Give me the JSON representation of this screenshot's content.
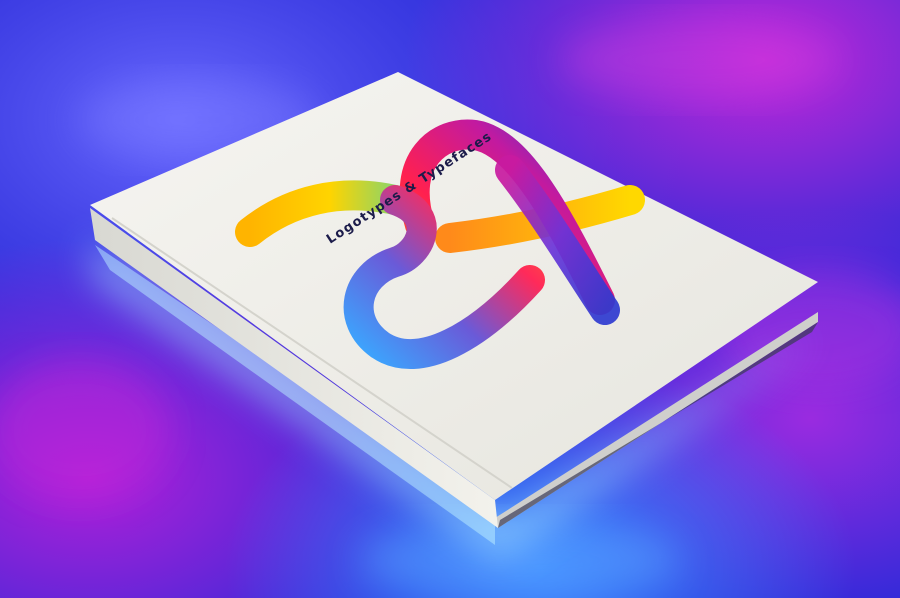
{
  "photo": {
    "subject": "book",
    "cover": {
      "title": "Logotypes & Typefaces",
      "title_color": "#1b1b4a",
      "cover_color": "#efeee8",
      "ribbon_colors": [
        "#ffd400",
        "#ff7a1a",
        "#ff2a5a",
        "#d11ea8",
        "#3a3ad8",
        "#2fa8ff"
      ]
    },
    "background_colors": [
      "#2a2ad8",
      "#6b22e0",
      "#c028d8",
      "#3b7bff",
      "#8fd0ff"
    ]
  }
}
